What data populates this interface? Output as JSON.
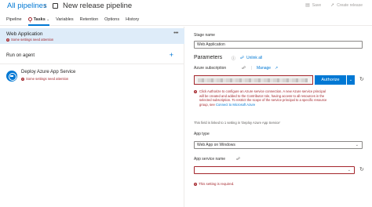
{
  "header": {
    "breadcrumb": "All pipelines",
    "separator": "›",
    "title": "New release pipeline",
    "actions": [
      {
        "icon": "save-icon",
        "label": "Save"
      },
      {
        "icon": "rocket-icon",
        "label": "Create release"
      }
    ]
  },
  "tabs": [
    {
      "label": "Pipeline"
    },
    {
      "label": "Tasks",
      "has_error": true,
      "active": true
    },
    {
      "label": "Variables"
    },
    {
      "label": "Retention"
    },
    {
      "label": "Options"
    },
    {
      "label": "History"
    }
  ],
  "stage": {
    "title": "Web Application",
    "warning": "Some settings need attention"
  },
  "agent": {
    "label": "Run on agent"
  },
  "task": {
    "title": "Deploy Azure App Service",
    "warning": "Some settings need attention"
  },
  "form": {
    "stage_name_label": "Stage name",
    "stage_name_value": "Web Application",
    "parameters_heading": "Parameters",
    "unlink_all": "Unlink all",
    "subscription_label": "Azure subscription",
    "manage_link": "Manage",
    "authorize_button": "Authorize",
    "auth_error_text": "Click Authorize to configure an Azure service connection. A new Azure service principal will be created and added to the Contributor role, having access to all resources in the selected subscription. To restrict the scope of the service principal to a specific resource group, see ",
    "auth_error_link": "Connect to Microsoft Azure",
    "linked_note": "This field is linked to 1 setting in 'Deploy Azure App Service'",
    "app_type_label": "App type",
    "app_type_value": "Web App on Windows",
    "app_service_label": "App service name",
    "app_service_value": "",
    "required_error": "This setting is required."
  },
  "colors": {
    "accent": "#0078d4",
    "error": "#a4262c",
    "selected_stage_bg": "#deecf9"
  }
}
